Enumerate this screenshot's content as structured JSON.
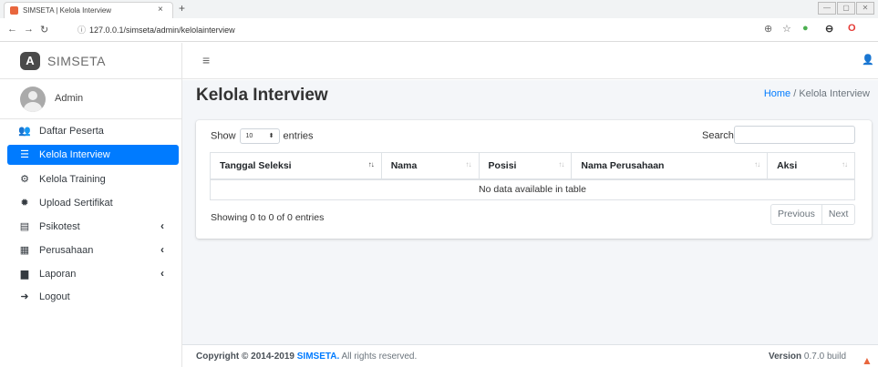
{
  "browser": {
    "tab_title": "SIMSETA | Kelola Interview",
    "tab_close": "×",
    "new_tab": "+",
    "url": "127.0.0.1/simseta/admin/kelolainterview",
    "controls": [
      "—",
      "▢",
      "✕"
    ]
  },
  "brand": {
    "logo": "A",
    "name": "SIMSETA"
  },
  "user": {
    "name": "Admin"
  },
  "sidebar": {
    "items": [
      {
        "label": "Daftar Peserta",
        "icon": "users-icon",
        "glyph": "👥",
        "caret": ""
      },
      {
        "label": "Kelola Interview",
        "icon": "list-icon",
        "glyph": "☰",
        "caret": ""
      },
      {
        "label": "Kelola Training",
        "icon": "cogs-icon",
        "glyph": "⚙",
        "caret": ""
      },
      {
        "label": "Upload Sertifikat",
        "icon": "certificate-icon",
        "glyph": "✹",
        "caret": ""
      },
      {
        "label": "Psikotest",
        "icon": "table-icon",
        "glyph": "▤",
        "caret": "‹"
      },
      {
        "label": "Perusahaan",
        "icon": "building-icon",
        "glyph": "▦",
        "caret": "‹"
      },
      {
        "label": "Laporan",
        "icon": "file-icon",
        "glyph": "▆",
        "caret": "‹"
      },
      {
        "label": "Logout",
        "icon": "sign-out-icon",
        "glyph": "➜",
        "caret": ""
      }
    ]
  },
  "header": {
    "menu_glyph": "≡",
    "user_glyph": "👤"
  },
  "page": {
    "title": "Kelola Interview",
    "breadcrumb_home": "Home",
    "breadcrumb_sep": " / ",
    "breadcrumb_current": "Kelola Interview"
  },
  "table": {
    "show_label": "Show",
    "entries_value": "10",
    "entries_label": "entries",
    "search_label": "Search:",
    "columns": [
      "Tanggal Seleksi",
      "Nama",
      "Posisi",
      "Nama Perusahaan",
      "Aksi"
    ],
    "empty_message": "No data available in table",
    "info": "Showing 0 to 0 of 0 entries",
    "prev_label": "Previous",
    "next_label": "Next"
  },
  "footer": {
    "copyright_prefix": "Copyright © 2014-2019 ",
    "brand": "SIMSETA.",
    "rights": " All rights reserved.",
    "version_label": "Version",
    "version_value": " 0.7.0 build"
  },
  "colors": {
    "accent": "#007bff",
    "content_bg": "#f4f6f9"
  }
}
